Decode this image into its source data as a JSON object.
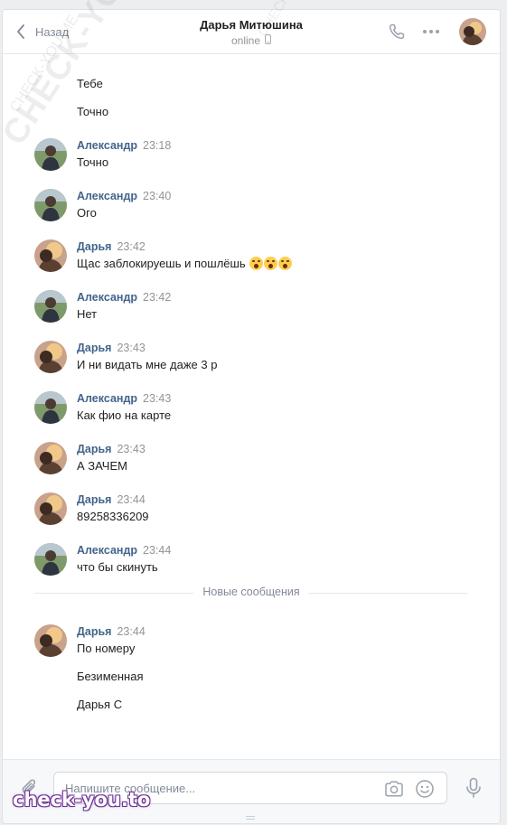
{
  "header": {
    "back_label": "Назад",
    "title": "Дарья Митюшина",
    "status": "online"
  },
  "messages": [
    {
      "type": "continuation",
      "text": "Тебе"
    },
    {
      "type": "continuation",
      "text": "Точно"
    },
    {
      "type": "message",
      "author": "Александр",
      "time": "23:18",
      "lines": [
        "Точно"
      ]
    },
    {
      "type": "message",
      "author": "Александр",
      "time": "23:40",
      "lines": [
        "Ого"
      ]
    },
    {
      "type": "message",
      "author": "Дарья",
      "time": "23:42",
      "lines": [
        "Щас заблокируешь и пошлёшь"
      ],
      "emoji_count": 3
    },
    {
      "type": "message",
      "author": "Александр",
      "time": "23:42",
      "lines": [
        "Нет"
      ]
    },
    {
      "type": "message",
      "author": "Дарья",
      "time": "23:43",
      "lines": [
        "И ни видать мне даже 3 р"
      ]
    },
    {
      "type": "message",
      "author": "Александр",
      "time": "23:43",
      "lines": [
        "Как фио на карте"
      ]
    },
    {
      "type": "message",
      "author": "Дарья",
      "time": "23:43",
      "lines": [
        "А ЗАЧЕМ"
      ]
    },
    {
      "type": "message",
      "author": "Дарья",
      "time": "23:44",
      "lines": [
        "89258336209"
      ]
    },
    {
      "type": "message",
      "author": "Александр",
      "time": "23:44",
      "lines": [
        "что бы скинуть"
      ]
    },
    {
      "type": "divider",
      "text": "Новые сообщения"
    },
    {
      "type": "message",
      "author": "Дарья",
      "time": "23:44",
      "lines": [
        "По номеру",
        "Безименная",
        "Дарья С"
      ]
    }
  ],
  "composer": {
    "placeholder": "Напишите сообщение..."
  },
  "icons": {
    "back": "chevron-left-icon",
    "call": "phone-icon",
    "more": "more-icon",
    "attach": "paperclip-icon",
    "camera": "camera-icon",
    "emoji": "smile-icon",
    "mic": "microphone-icon",
    "mobile": "mobile-icon"
  },
  "watermarks": {
    "diagonal": "CHECK-YOU.ME",
    "bottom": "check-you.to"
  },
  "colors": {
    "author_link": "#42648b",
    "text": "#222222",
    "meta": "#939393",
    "background": "#edeef0"
  }
}
